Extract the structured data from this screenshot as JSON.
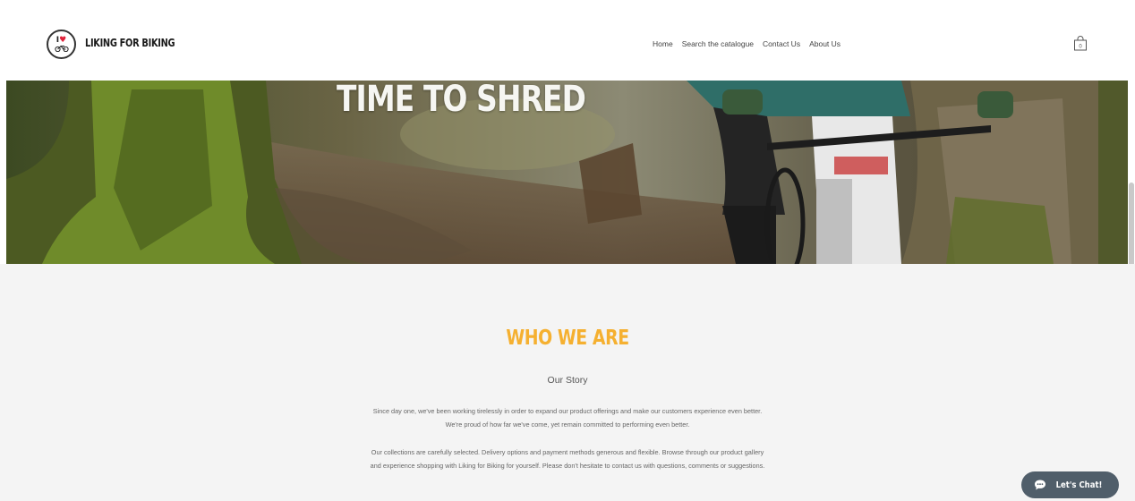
{
  "brand": {
    "name": "LIKING FOR BIKING",
    "logo_text": "I"
  },
  "nav": {
    "items": [
      "Home",
      "Search the catalogue",
      "Contact Us",
      "About Us"
    ]
  },
  "cart": {
    "count": "0"
  },
  "hero": {
    "title": "TIME TO SHRED"
  },
  "about": {
    "heading": "WHO WE ARE",
    "subheading": "Our Story",
    "paragraph1": "Since day one, we've been working tirelessly in order to expand our product offerings and make our customers experience even better. We're proud of how far we've come, yet remain committed to performing even better.",
    "paragraph2": "Our collections are carefully selected. Delivery options and payment methods generous and flexible. Browse through our product gallery and experience shopping with Liking for Biking for yourself. Please don't hesitate to contact us with questions, comments or suggestions."
  },
  "chat": {
    "label": "Let's Chat!"
  },
  "colors": {
    "accent": "#f5b030",
    "chat_bg": "#505e6a",
    "section_bg": "#f4f4f4"
  },
  "icons": {
    "logo": "heart-bike-logo-icon",
    "cart": "shopping-bag-icon",
    "chat": "chat-bubble-icon"
  }
}
